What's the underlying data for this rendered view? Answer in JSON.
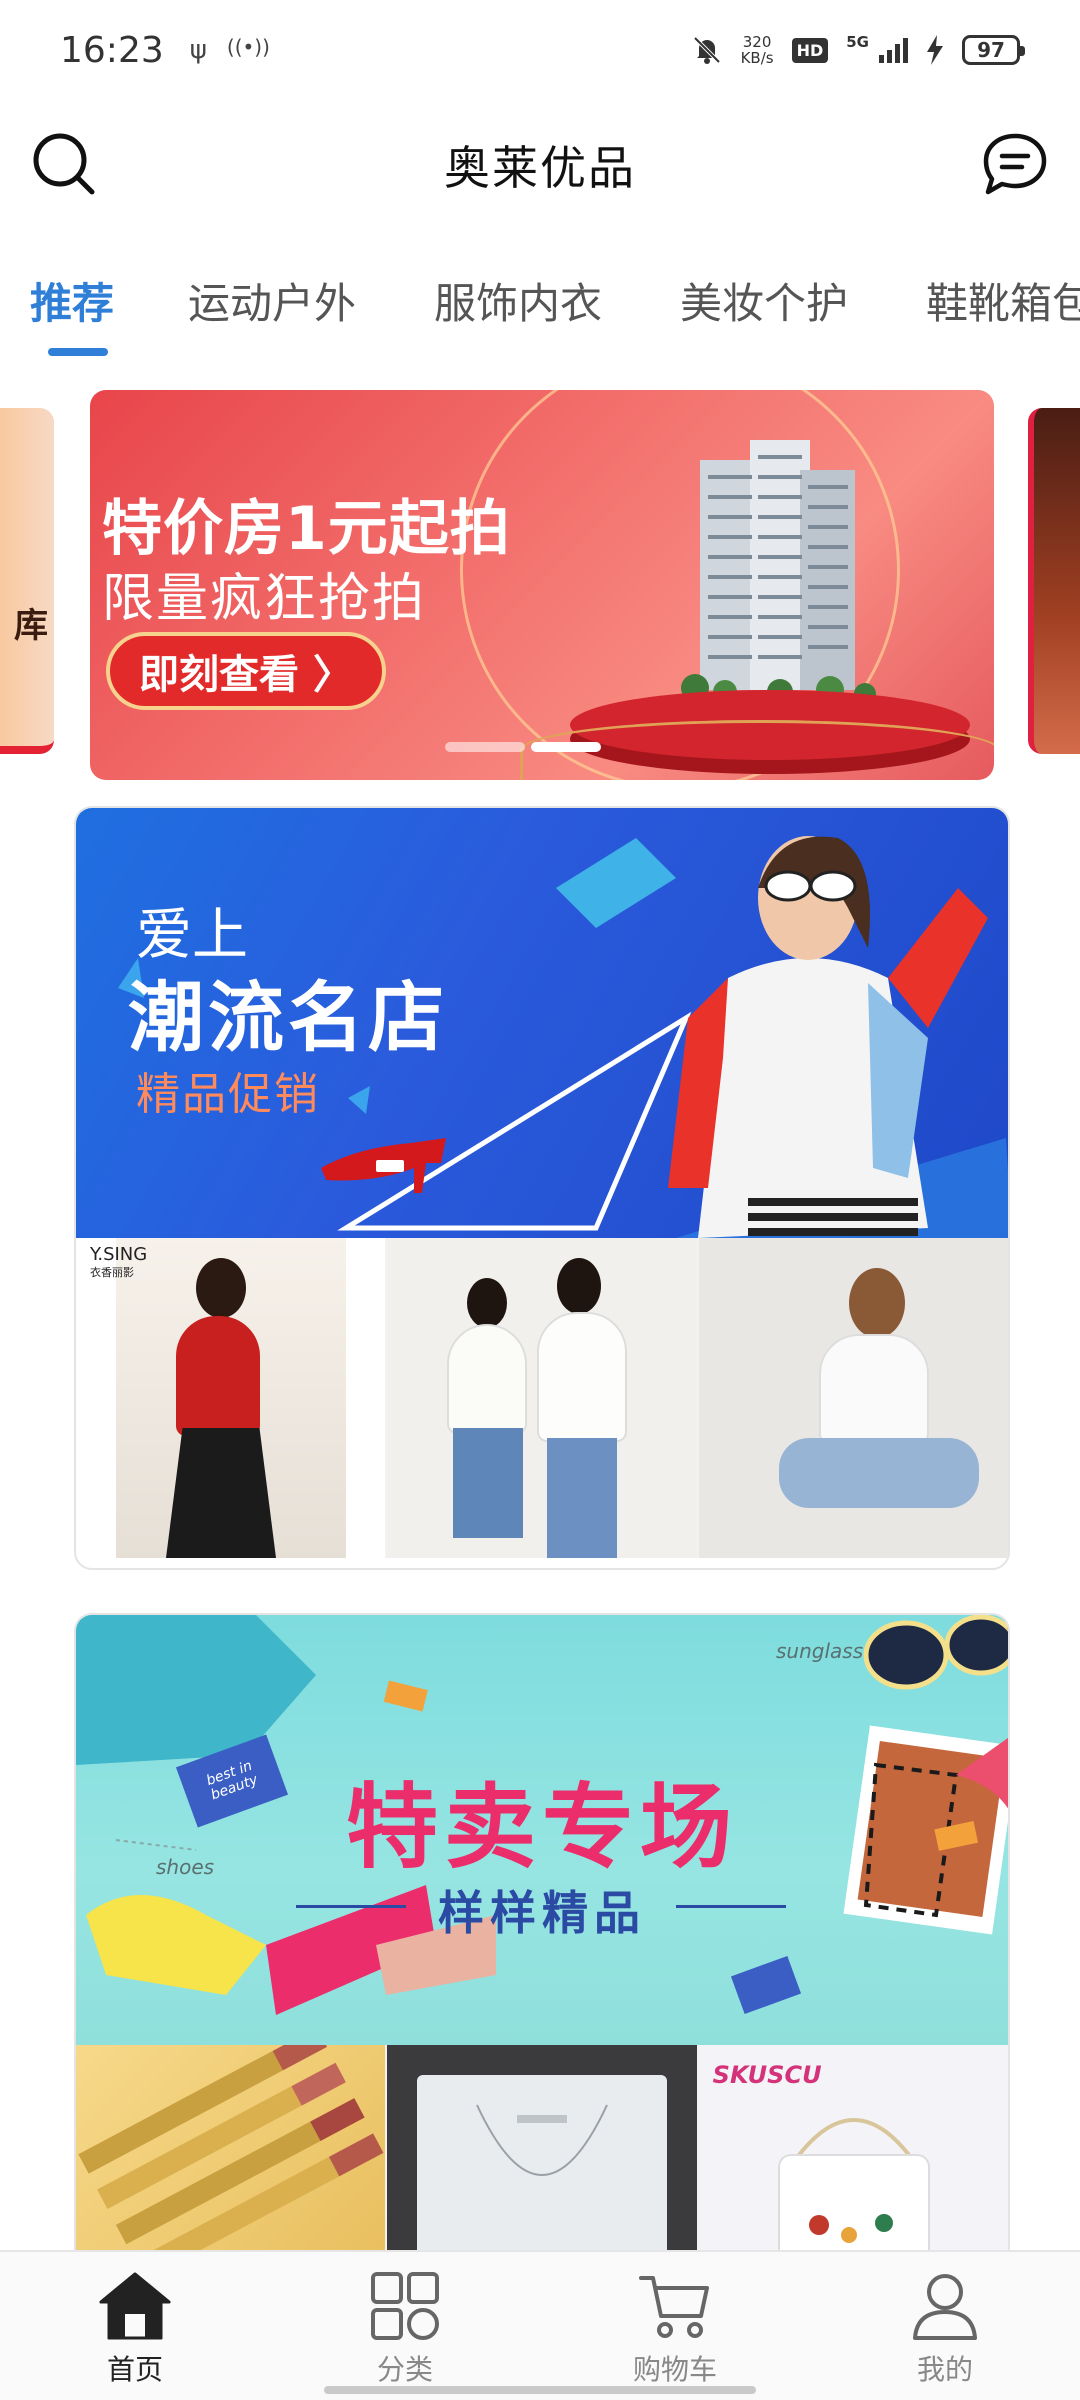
{
  "status_bar": {
    "time": "16:23",
    "usb_icon": "ψ",
    "hotspot_icon": "((•))",
    "net_speed_value": "320",
    "net_speed_unit": "KB/s",
    "hd_badge": "HD",
    "network_type": "5G",
    "battery": "97"
  },
  "header": {
    "title": "奥莱优品",
    "search_icon": "search-icon",
    "message_icon": "message-icon"
  },
  "tabs": [
    {
      "label": "推荐",
      "active": true
    },
    {
      "label": "运动户外",
      "active": false
    },
    {
      "label": "服饰内衣",
      "active": false
    },
    {
      "label": "美妆个护",
      "active": false
    },
    {
      "label": "鞋靴箱包",
      "active": false
    }
  ],
  "carousel": {
    "prev_slide_text": "库",
    "main_slide": {
      "title": "特价房1元起拍",
      "subtitle": "限量疯狂抢拍",
      "button": "即刻查看 〉"
    },
    "dots": 2,
    "active_dot": 1
  },
  "promo_fashion": {
    "line1": "爱上",
    "line2": "潮流名店",
    "line3": "精品促销",
    "tile_brand": "Y.SING",
    "tile_brand_sub": "衣香丽影"
  },
  "promo_sale": {
    "title": "特卖专场",
    "subtitle": "样样精品",
    "script_sunglass": "sunglass",
    "script_shoes": "shoes",
    "badge_note": "best in beauty",
    "tile_brand": "SKUSCU"
  },
  "bottom_nav": [
    {
      "label": "首页",
      "icon": "home-icon",
      "active": true
    },
    {
      "label": "分类",
      "icon": "category-grid-icon",
      "active": false
    },
    {
      "label": "购物车",
      "icon": "cart-icon",
      "active": false
    },
    {
      "label": "我的",
      "icon": "profile-icon",
      "active": false
    }
  ],
  "colors": {
    "accent": "#2f7fd8",
    "sale_pink": "#ec2d6b",
    "banner_red": "#e8454a",
    "banner_blue": "#1f6fe0"
  }
}
